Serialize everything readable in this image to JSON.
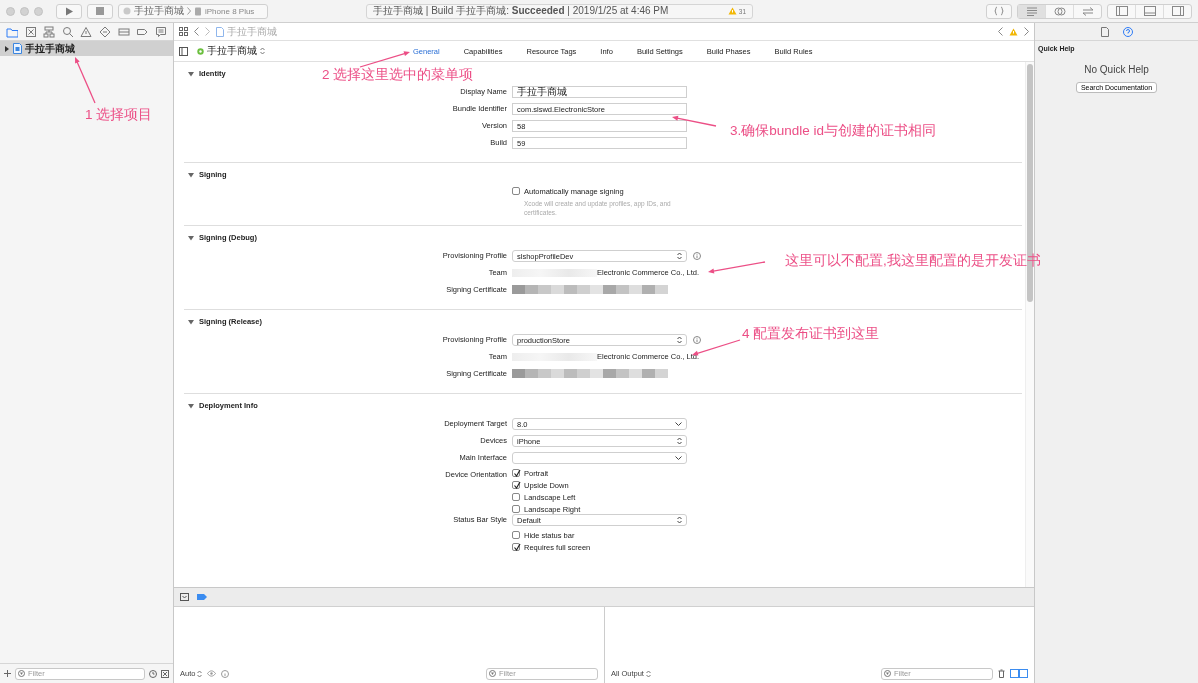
{
  "toolbar": {
    "scheme": "手拉手商城",
    "device": "iPhone 8 Plus",
    "activity": "手拉手商城 | Build 手拉手商城: **Succeeded** | 2019/1/25 at 4:46 PM",
    "warning_count": "31",
    "editor_modes": [
      {
        "selected": true
      },
      {
        "selected": false
      },
      {
        "selected": false
      }
    ]
  },
  "navigator": {
    "tabs": [
      {
        "selected": true
      },
      {
        "selected": false
      },
      {
        "selected": false
      },
      {
        "selected": false
      },
      {
        "selected": false
      },
      {
        "selected": false
      },
      {
        "selected": false
      },
      {
        "selected": false
      },
      {
        "selected": false
      }
    ],
    "items": [
      {
        "label": "手拉手商城",
        "selected": true,
        "expanded": false
      }
    ],
    "filter": {
      "placeholder": "Filter"
    }
  },
  "editor": {
    "breadcrumb": "手拉手商城",
    "target": "手拉手商城",
    "tabs": [
      {
        "label": "General",
        "selected": true
      },
      {
        "label": "Capabilities",
        "selected": false
      },
      {
        "label": "Resource Tags",
        "selected": false
      },
      {
        "label": "Info",
        "selected": false
      },
      {
        "label": "Build Settings",
        "selected": false
      },
      {
        "label": "Build Phases",
        "selected": false
      },
      {
        "label": "Build Rules",
        "selected": false
      }
    ],
    "sections": [
      {
        "title": "Identity",
        "expanded": true,
        "rows": [
          {
            "kind": "text",
            "label": "Display Name",
            "value": "手拉手商城"
          },
          {
            "kind": "text",
            "label": "Bundle Identifier",
            "value": "com.slswd.ElectronicStore"
          },
          {
            "kind": "text",
            "label": "Version",
            "value": "58"
          },
          {
            "kind": "text",
            "label": "Build",
            "value": "59"
          }
        ]
      },
      {
        "title": "Signing",
        "expanded": true,
        "rows": [
          {
            "kind": "checks",
            "options": [
              {
                "label": "Automatically manage signing",
                "checked": false,
                "note": "Xcode will create and update profiles, app IDs, and certificates."
              }
            ]
          }
        ]
      },
      {
        "title": "Signing (Debug)",
        "expanded": true,
        "rows": [
          {
            "kind": "popup",
            "label": "Provisioning Profile",
            "value": "slshopProfileDev",
            "info": true
          },
          {
            "kind": "masked",
            "label": "Team",
            "value": "Electronic Commerce Co., Ltd."
          },
          {
            "kind": "redacted",
            "label": "Signing Certificate"
          }
        ]
      },
      {
        "title": "Signing (Release)",
        "expanded": true,
        "rows": [
          {
            "kind": "popup",
            "label": "Provisioning Profile",
            "value": "productionStore",
            "info": true
          },
          {
            "kind": "masked",
            "label": "Team",
            "value": "Electronic Commerce Co., Ltd."
          },
          {
            "kind": "redacted",
            "label": "Signing Certificate"
          }
        ]
      },
      {
        "title": "Deployment Info",
        "expanded": true,
        "rows": [
          {
            "kind": "combo",
            "label": "Deployment Target",
            "value": "8.0"
          },
          {
            "kind": "popup",
            "label": "Devices",
            "value": "iPhone",
            "info": false
          },
          {
            "kind": "combo",
            "label": "Main Interface"
          },
          {
            "kind": "checks",
            "label": "Device Orientation",
            "options": [
              {
                "label": "Portrait",
                "checked": true
              },
              {
                "label": "Upside Down",
                "checked": true
              },
              {
                "label": "Landscape Left",
                "checked": false
              },
              {
                "label": "Landscape Right",
                "checked": false
              }
            ]
          },
          {
            "kind": "popup",
            "label": "Status Bar Style",
            "value": "Default",
            "info": false
          },
          {
            "kind": "checks",
            "options": [
              {
                "label": "Hide status bar",
                "checked": false
              },
              {
                "label": "Requires full screen",
                "checked": true
              }
            ]
          }
        ]
      }
    ]
  },
  "debug": {
    "variables": {
      "scope": "Auto",
      "filter": {
        "placeholder": "Filter"
      }
    },
    "console": {
      "output": "All Output",
      "filter": {
        "placeholder": "Filter"
      }
    }
  },
  "inspector": {
    "tabs": [
      {
        "selected": false
      },
      {
        "selected": true
      }
    ],
    "title": "Quick Help",
    "message": "No Quick Help",
    "button": "Search Documentation"
  },
  "annotations": [
    {
      "text": "1 选择项目"
    },
    {
      "text": "2 选择这里选中的菜单项"
    },
    {
      "text": "3.确保bundle id与创建的证书相同"
    },
    {
      "text": "这里可以不配置,我这里配置的是开发证书"
    },
    {
      "text": "4 配置发布证书到这里"
    }
  ]
}
